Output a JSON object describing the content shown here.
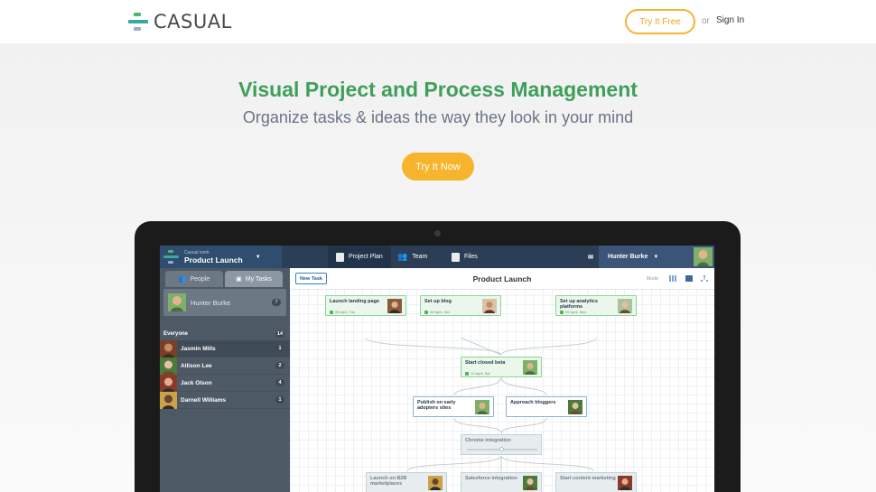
{
  "colors": {
    "brand_green": "#3f9f5a",
    "accent_orange": "#f6b52c",
    "nav_navy": "#2c3e55",
    "sidebar_grey": "#4d5a66",
    "task_green_bg": "#eaf8ec"
  },
  "header": {
    "logo_text": "CASUAL",
    "try_free_label": "Try It Free",
    "or_text": "or",
    "sign_in_label": "Sign In"
  },
  "hero": {
    "headline": "Visual Project and Process Management",
    "subheadline": "Organize tasks & ideas the way they look in your mind",
    "cta_label": "Try It Now"
  },
  "app": {
    "project_selector": {
      "subtitle": "Casual work",
      "name": "Product Launch"
    },
    "tabs": [
      {
        "label": "Project Plan",
        "icon": "document-icon"
      },
      {
        "label": "Team",
        "icon": "people-icon"
      },
      {
        "label": "Files",
        "icon": "files-icon"
      }
    ],
    "mail_icon": "mail-icon",
    "help_label": "?",
    "user_name": "Hunter Burke",
    "sidebar": {
      "tab_people": "People",
      "tab_my_tasks": "My Tasks",
      "me": {
        "name": "Hunter Burke",
        "count": "7"
      },
      "group": {
        "name": "Everyone",
        "count": "14"
      },
      "people": [
        {
          "name": "Jasmin Mills",
          "count": "1"
        },
        {
          "name": "Allison Lee",
          "count": "2"
        },
        {
          "name": "Jack Olson",
          "count": "4"
        },
        {
          "name": "Darnell Williams",
          "count": "1"
        }
      ]
    },
    "board": {
      "new_task_label": "New Task",
      "title": "Product Launch",
      "mode_label": "Mode:",
      "tasks": [
        {
          "title": "Launch landing page",
          "date": "06 April, Thu"
        },
        {
          "title": "Set up blog",
          "date": "08 April, Sat"
        },
        {
          "title": "Set up analytics platforms",
          "date": "09 April, Mon"
        },
        {
          "title": "Start closed beta",
          "date": "12 April, Sat"
        },
        {
          "title": "Publish on early adopters sites",
          "date": ""
        },
        {
          "title": "Approach bloggers",
          "date": ""
        },
        {
          "title": "Chrome integration",
          "date": ""
        },
        {
          "title": "Launch on B2B marketplaces",
          "date": ""
        },
        {
          "title": "Salesforce integration",
          "date": ""
        },
        {
          "title": "Start content marketing",
          "date": ""
        }
      ]
    }
  }
}
